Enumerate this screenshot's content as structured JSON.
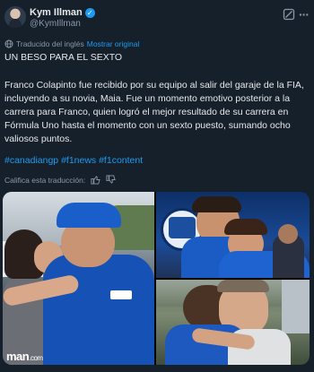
{
  "author": {
    "name": "Kym Illman",
    "handle": "@KymIllman"
  },
  "translation_bar": {
    "translated_from": "Traducido del inglés",
    "show_original": "Mostrar original"
  },
  "post": {
    "title": "UN BESO PARA EL SEXTO",
    "body": "Franco Colapinto fue recibido por su equipo al salir del garaje de la FIA, incluyendo a su novia, Maia. Fue un momento emotivo posterior a la carrera para Franco, quien logró el mejor resultado de su carrera en Fórmula Uno hasta el momento con un sexto puesto, sumando ocho valiosos puntos.",
    "hashtags": [
      "#canadiangp",
      "#f1news",
      "#f1content"
    ]
  },
  "rate_translation": {
    "label": "Califica esta traducción:"
  },
  "media": {
    "watermark": "man",
    "watermark_suffix": ".com"
  },
  "colors": {
    "background": "#15202b",
    "accent": "#1d9bf0",
    "muted_text": "#8b98a5"
  },
  "icons": [
    "verified-badge-icon",
    "grok-icon",
    "more-icon",
    "globe-icon",
    "thumbs-up-icon",
    "thumbs-down-icon"
  ]
}
